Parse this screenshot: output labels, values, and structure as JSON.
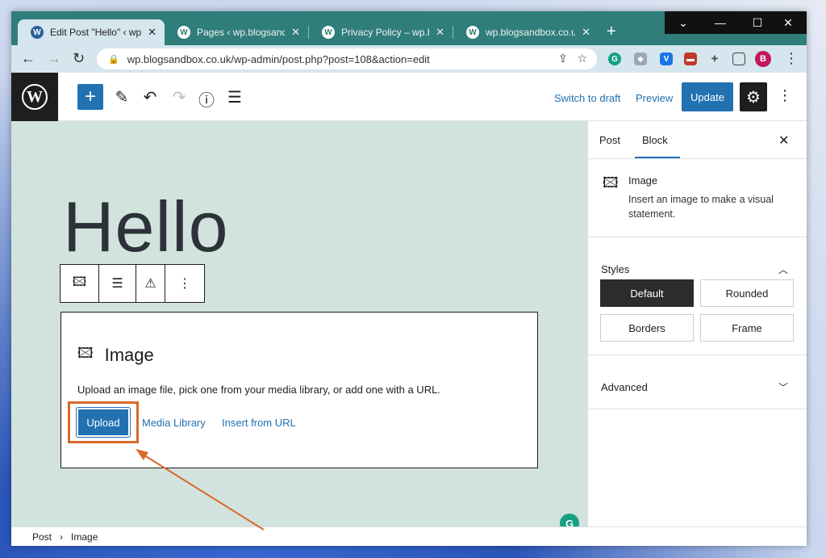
{
  "browser": {
    "tabs": [
      {
        "title": "Edit Post \"Hello\" ‹ wp.b",
        "active": true
      },
      {
        "title": "Pages ‹ wp.blogsandbox",
        "active": false
      },
      {
        "title": "Privacy Policy – wp.blog",
        "active": false
      },
      {
        "title": "wp.blogsandbox.co.uk",
        "active": false
      }
    ],
    "tab_close": "✕",
    "new_tab": "+",
    "url": "wp.blogsandbox.co.uk/wp-admin/post.php?post=108&action=edit",
    "profile_initial": "B"
  },
  "toolbar": {
    "switch_to_draft": "Switch to draft",
    "preview": "Preview",
    "update": "Update"
  },
  "editor": {
    "heading": "Hello",
    "image_block": {
      "title": "Image",
      "description": "Upload an image file, pick one from your media library, or add one with a URL.",
      "upload": "Upload",
      "media_library": "Media Library",
      "insert_from_url": "Insert from URL"
    }
  },
  "sidebar": {
    "tab_post": "Post",
    "tab_block": "Block",
    "block_name": "Image",
    "block_desc": "Insert an image to make a visual statement.",
    "styles_label": "Styles",
    "styles": [
      "Default",
      "Rounded",
      "Borders",
      "Frame"
    ],
    "advanced_label": "Advanced"
  },
  "breadcrumb": [
    "Post",
    "Image"
  ],
  "colors": {
    "accent": "#2271b1",
    "highlight": "#d86a2a",
    "canvas": "#d2e3dd"
  }
}
